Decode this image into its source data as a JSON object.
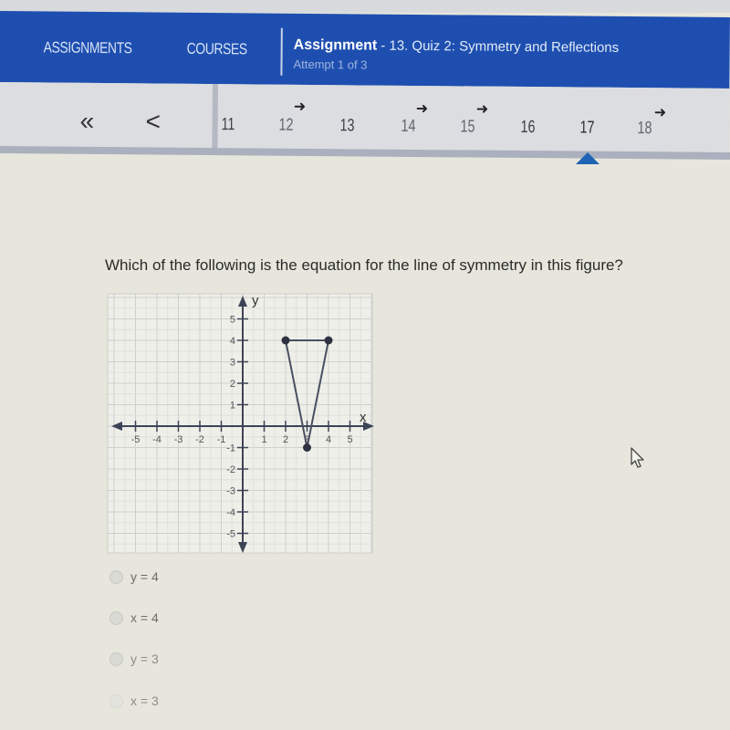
{
  "header": {
    "nav_links": [
      "ASSIGNMENTS",
      "COURSES"
    ],
    "assignment_label": "Assignment",
    "assignment_name": "- 13. Quiz 2: Symmetry and Reflections",
    "attempt": "Attempt 1 of 3",
    "brand_color": "#1e4fb0"
  },
  "question_nav": {
    "first_icon": "«",
    "prev_icon": "<",
    "questions": [
      {
        "number": "11",
        "flagged": false
      },
      {
        "number": "12",
        "flagged": true
      },
      {
        "number": "13",
        "flagged": false
      },
      {
        "number": "14",
        "flagged": true
      },
      {
        "number": "15",
        "flagged": true
      },
      {
        "number": "16",
        "flagged": false
      },
      {
        "number": "17",
        "flagged": false,
        "current": true
      },
      {
        "number": "18",
        "flagged": true
      }
    ],
    "flag_icon": "➜",
    "current_marker_color": "#1f63b4"
  },
  "question": {
    "text": "Which of the following is the equation for the line of symmetry in this figure?"
  },
  "chart_data": {
    "type": "scatter",
    "title": "",
    "xlabel": "x",
    "ylabel": "y",
    "xlim": [
      -5,
      5
    ],
    "ylim": [
      -5,
      5
    ],
    "grid": true,
    "x_ticks": [
      "-5",
      "-4",
      "-3",
      "-2",
      "-1",
      "1",
      "2",
      "3",
      "4",
      "5"
    ],
    "y_ticks": [
      "5",
      "4",
      "3",
      "2",
      "1",
      "-1",
      "-2",
      "-3",
      "-4",
      "-5"
    ],
    "polygon": {
      "name": "triangle",
      "points": [
        [
          2,
          4
        ],
        [
          4,
          4
        ],
        [
          3,
          -1
        ]
      ],
      "closed": true
    }
  },
  "choices": [
    {
      "label": "y = 4"
    },
    {
      "label": "x = 4"
    },
    {
      "label": "y = 3"
    },
    {
      "label": "x = 3"
    }
  ]
}
